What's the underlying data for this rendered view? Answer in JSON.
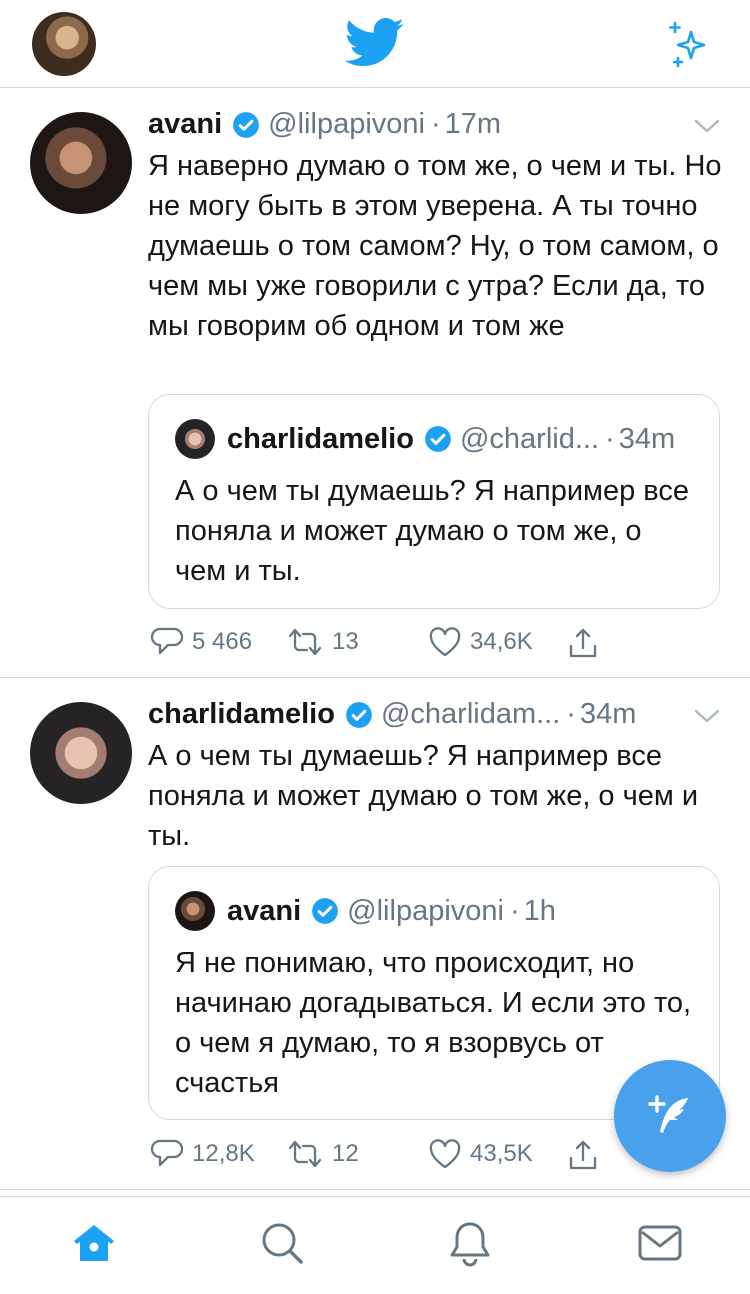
{
  "top_bar": {
    "profile_avatar": "profile-avatar",
    "logo": "twitter-bird-icon",
    "sparkle": "sparkle-icon",
    "brand_color": "#1da1f2"
  },
  "tweets": [
    {
      "name": "avani",
      "handle": "@lilpapivoni",
      "time": "17m",
      "text": "Я наверно думаю о том же, о чем и ты. Но не могу быть в этом уверена. А ты точно думаешь о том самом? Ну, о том самом, о чем мы уже говорили с утра? Если да, то мы говорим об одном и том же",
      "quote": {
        "name": "charlidamelio",
        "handle": "@charlid...",
        "time": "34m",
        "text": "А о чем ты думаешь? Я например все поняла и может думаю о том же, о чем и ты."
      },
      "replies": "5 466",
      "retweets": "13",
      "likes": "34,6K"
    },
    {
      "name": "charlidamelio",
      "handle": "@charlidam...",
      "time": "34m",
      "text": "А о чем ты думаешь? Я например все поняла и может думаю о том же, о чем и ты.",
      "quote": {
        "name": "avani",
        "handle": "@lilpapivoni",
        "time": "1h",
        "text": "Я не понимаю, что происходит, но начинаю догадываться. И если это то, о чем я думаю, то я взорвусь от счастья"
      },
      "replies": "12,8K",
      "retweets": "12",
      "likes": "43,5K"
    }
  ],
  "separator": "·",
  "tab_bar": [
    "home-icon",
    "search-icon",
    "notifications-icon",
    "messages-icon"
  ],
  "colors": {
    "accent": "#1da1f2",
    "secondary_text": "#657786",
    "border": "#d6dadd"
  }
}
